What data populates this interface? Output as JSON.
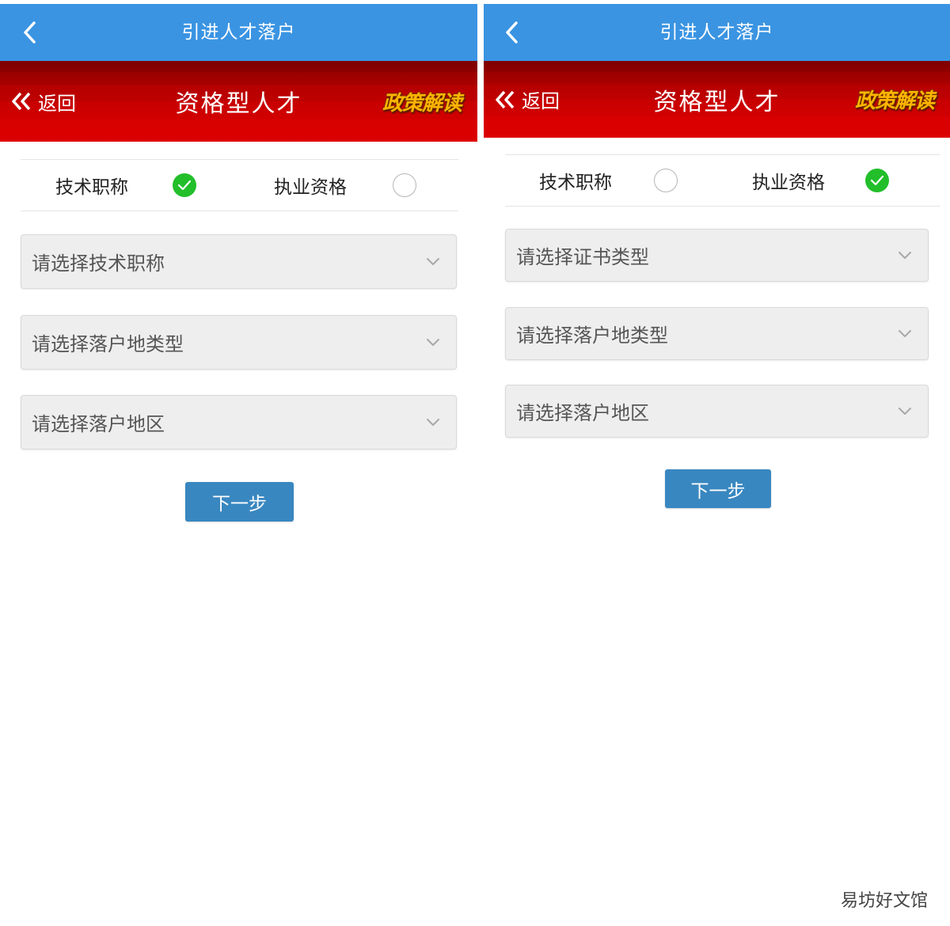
{
  "left": {
    "topbar": {
      "title": "引进人才落户"
    },
    "header": {
      "back_label": "返回",
      "title": "资格型人才",
      "policy_label": "政策解读"
    },
    "radio": {
      "option1": {
        "label": "技术职称",
        "checked": true
      },
      "option2": {
        "label": "执业资格",
        "checked": false
      }
    },
    "selects": [
      {
        "placeholder": "请选择技术职称"
      },
      {
        "placeholder": "请选择落户地类型"
      },
      {
        "placeholder": "请选择落户地区"
      }
    ],
    "next_label": "下一步"
  },
  "right": {
    "topbar": {
      "title": "引进人才落户"
    },
    "header": {
      "back_label": "返回",
      "title": "资格型人才",
      "policy_label": "政策解读"
    },
    "radio": {
      "option1": {
        "label": "技术职称",
        "checked": false
      },
      "option2": {
        "label": "执业资格",
        "checked": true
      }
    },
    "selects": [
      {
        "placeholder": "请选择证书类型"
      },
      {
        "placeholder": "请选择落户地类型"
      },
      {
        "placeholder": "请选择落户地区"
      }
    ],
    "next_label": "下一步"
  },
  "watermark": "易坊好文馆",
  "colors": {
    "topbar": "#3a94e2",
    "header_red": "#c80000",
    "check_green": "#22bf2a",
    "button_blue": "#3987c0",
    "policy_gold": "#ffb400"
  },
  "icons": [
    "chevron-left-icon",
    "double-chevron-left-icon",
    "check-icon",
    "chevron-down-icon"
  ]
}
